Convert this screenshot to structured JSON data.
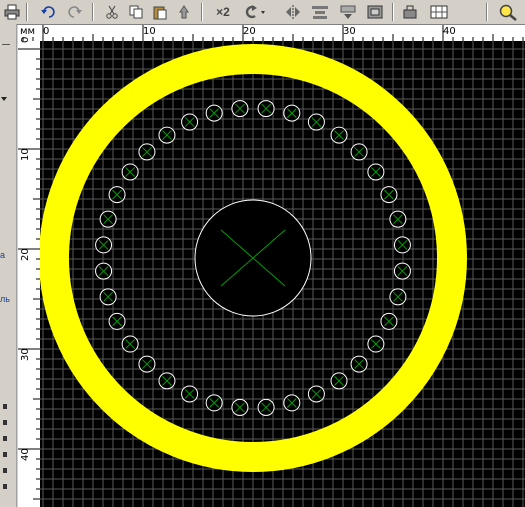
{
  "toolbar": {
    "buttons": [
      {
        "icon": "print-icon"
      },
      {
        "icon": "undo-icon"
      },
      {
        "icon": "redo-icon"
      },
      {
        "icon": "cut-icon"
      },
      {
        "icon": "copy-icon"
      },
      {
        "icon": "paste-icon"
      },
      {
        "icon": "delete-icon"
      },
      {
        "icon": "multiply-icon",
        "label": "×2"
      },
      {
        "icon": "rotate-icon"
      },
      {
        "icon": "mirror-horizontal-icon"
      },
      {
        "icon": "align-icon"
      },
      {
        "icon": "distribute-icon"
      },
      {
        "icon": "group-icon"
      },
      {
        "icon": "snap-icon"
      },
      {
        "icon": "grid-icon"
      },
      {
        "icon": "zoom-icon"
      }
    ]
  },
  "left_panel": {
    "labels": [
      "a",
      "ль"
    ]
  },
  "ruler": {
    "unit": "мм",
    "h_labels": [
      "0",
      "10",
      "20",
      "30",
      "40"
    ],
    "v_labels": [
      "0",
      "10",
      "20",
      "30",
      "40"
    ]
  },
  "canvas": {
    "background": "#000000",
    "grid_color": "#5a5a5a",
    "ring_color": "#ffff00",
    "hole_outline_color": "#ffffff",
    "cross_color": "#00a000",
    "hole_count": 36
  }
}
